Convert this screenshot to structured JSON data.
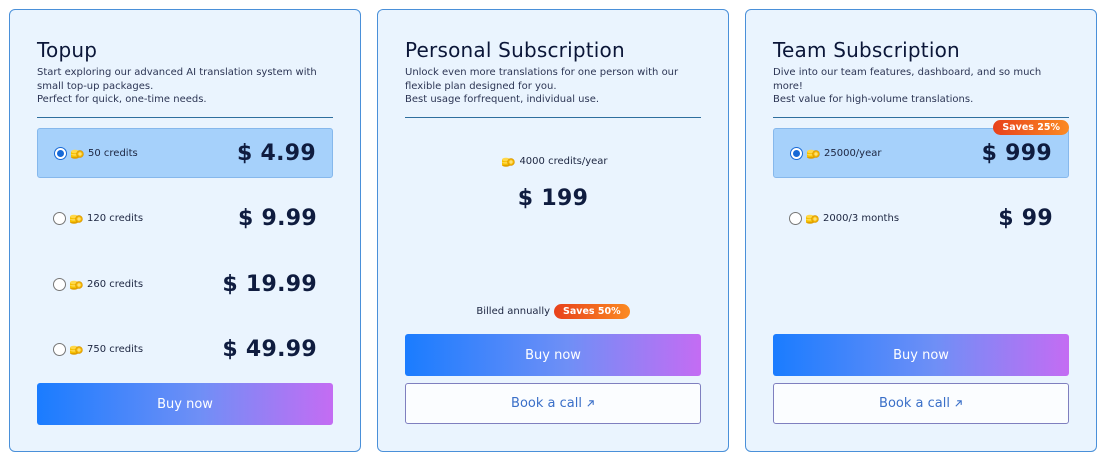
{
  "topup": {
    "title": "Topup",
    "desc": [
      "Start exploring our advanced AI translation system with small top-up packages.",
      "Perfect for quick, one-time needs."
    ],
    "options": [
      {
        "credits": "50 credits",
        "price": "$ 4.99",
        "selected": true
      },
      {
        "credits": "120 credits",
        "price": "$ 9.99",
        "selected": false
      },
      {
        "credits": "260 credits",
        "price": "$ 19.99",
        "selected": false
      },
      {
        "credits": "750 credits",
        "price": "$ 49.99",
        "selected": false
      }
    ],
    "buy_label": "Buy now"
  },
  "personal": {
    "title": "Personal Subscription",
    "desc": [
      "Unlock even more translations for one person with our flexible plan designed for you.",
      "Best usage forfrequent, individual use."
    ],
    "credits": "4000 credits/year",
    "price": "$ 199",
    "billing": "Billed annually",
    "badge": "Saves 50%",
    "buy_label": "Buy now",
    "call_label": "Book a call"
  },
  "team": {
    "title": "Team Subscription",
    "desc": [
      "Dive into our team features, dashboard, and so much more!",
      "Best value for high-volume translations."
    ],
    "options": [
      {
        "credits": "25000/year",
        "price": "$ 999",
        "selected": true,
        "badge": "Saves 25%"
      },
      {
        "credits": "2000/3 months",
        "price": "$ 99",
        "selected": false
      }
    ],
    "buy_label": "Buy now",
    "call_label": "Book a call"
  },
  "icons": {
    "coin": "coin-stack-icon",
    "external": "arrow-up-right-icon"
  },
  "colors": {
    "accent": "#1769d6",
    "card_bg": "#eaf4fe",
    "selected_bg": "#a6d1fb",
    "badge": "#f05a1f"
  }
}
